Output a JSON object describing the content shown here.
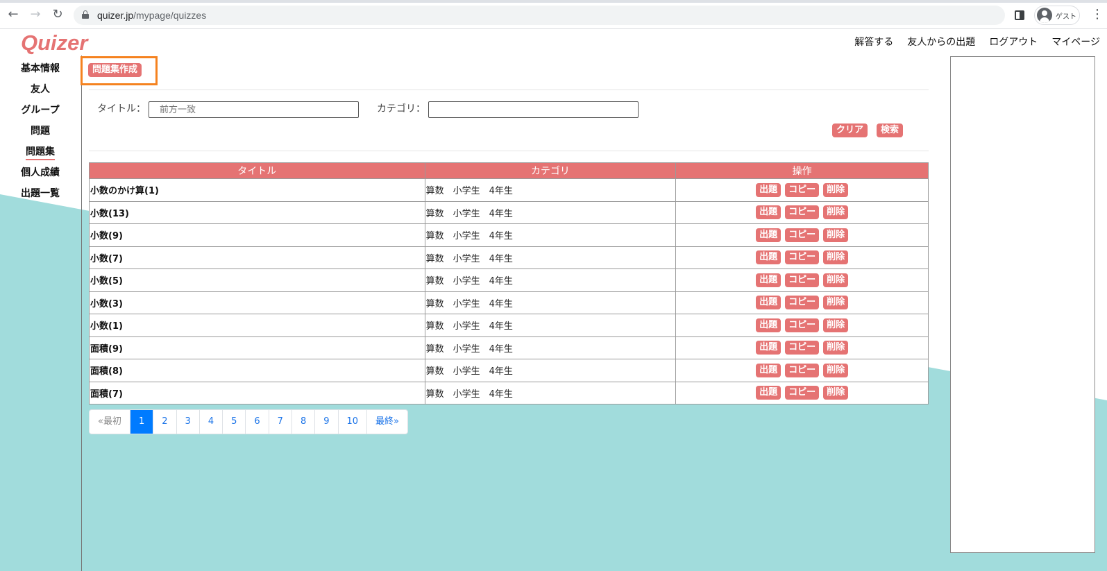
{
  "browser": {
    "url_host": "quizer.jp",
    "url_path": "/mypage/quizzes",
    "profile_label": "ゲスト"
  },
  "header": {
    "logo": "Quizer",
    "nav": [
      "解答する",
      "友人からの出題",
      "ログアウト",
      "マイページ"
    ]
  },
  "sidebar": {
    "items": [
      {
        "label": "基本情報"
      },
      {
        "label": "友人"
      },
      {
        "label": "グループ"
      },
      {
        "label": "問題"
      },
      {
        "label": "問題集"
      },
      {
        "label": "個人成績"
      },
      {
        "label": "出題一覧"
      }
    ],
    "active": "問題集"
  },
  "actions": {
    "create_label": "問題集作成"
  },
  "search": {
    "title_label": "タイトル：",
    "title_placeholder": "前方一致",
    "category_label": "カテゴリ：",
    "category_value": "",
    "clear_label": "クリア",
    "search_label": "検索"
  },
  "table": {
    "headers": [
      "タイトル",
      "カテゴリ",
      "操作"
    ],
    "op_labels": [
      "出題",
      "コピー",
      "削除"
    ],
    "rows": [
      {
        "title": "小数のかけ算(1)",
        "category": "算数　小学生　4年生"
      },
      {
        "title": "小数(13)",
        "category": "算数　小学生　4年生"
      },
      {
        "title": "小数(9)",
        "category": "算数　小学生　4年生"
      },
      {
        "title": "小数(7)",
        "category": "算数　小学生　4年生"
      },
      {
        "title": "小数(5)",
        "category": "算数　小学生　4年生"
      },
      {
        "title": "小数(3)",
        "category": "算数　小学生　4年生"
      },
      {
        "title": "小数(1)",
        "category": "算数　小学生　4年生"
      },
      {
        "title": "面積(9)",
        "category": "算数　小学生　4年生"
      },
      {
        "title": "面積(8)",
        "category": "算数　小学生　4年生"
      },
      {
        "title": "面積(7)",
        "category": "算数　小学生　4年生"
      }
    ]
  },
  "pagination": {
    "first": "«最初",
    "pages": [
      "1",
      "2",
      "3",
      "4",
      "5",
      "6",
      "7",
      "8",
      "9",
      "10"
    ],
    "current": "1",
    "last": "最終»"
  },
  "colors": {
    "accent": "#e57373",
    "wave": "#a1dcdc",
    "highlight": "#f5821f",
    "pager_active": "#007bff"
  }
}
